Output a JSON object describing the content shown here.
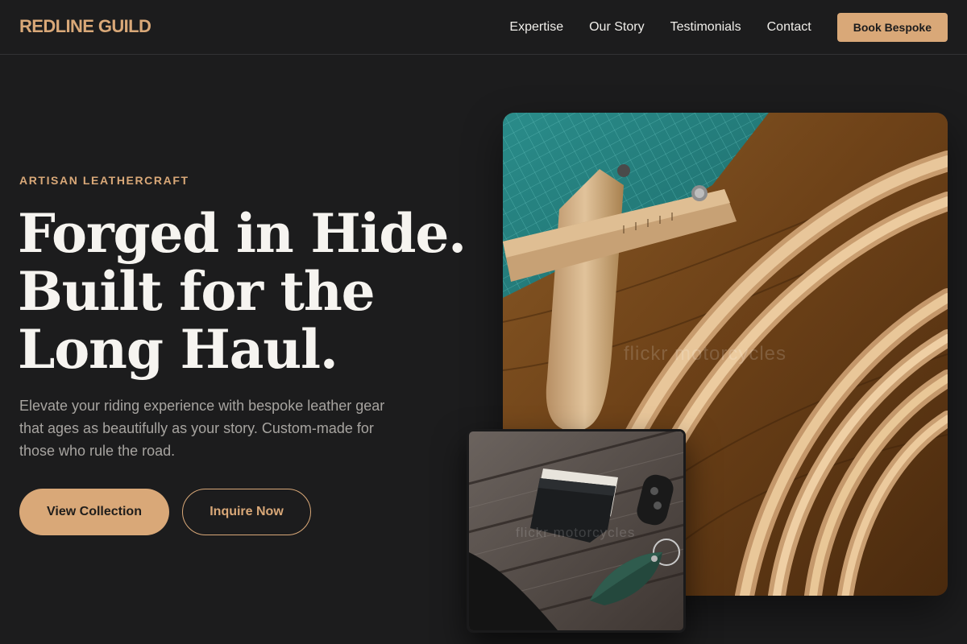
{
  "header": {
    "brand": "REDLINE GUILD",
    "nav": [
      "Expertise",
      "Our Story",
      "Testimonials",
      "Contact"
    ],
    "cta_label": "Book Bespoke"
  },
  "hero": {
    "eyebrow": "ARTISAN LEATHERCRAFT",
    "headline_lines": [
      "Forged in Hide.",
      "Built for the",
      "Long Haul."
    ],
    "body": "Elevate your riding experience with bespoke leather gear that ages as beautifully as your story. Custom-made for those who rule the road.",
    "primary_button": "View Collection",
    "secondary_button": "Inquire Now"
  },
  "images": {
    "main_watermark": "flickr motorcycles",
    "small_watermark": "flickr motorcycles"
  },
  "colors": {
    "background": "#1c1c1d",
    "accent": "#d9a878",
    "text": "#f6f4f0",
    "muted_text": "#a7a4a0"
  }
}
